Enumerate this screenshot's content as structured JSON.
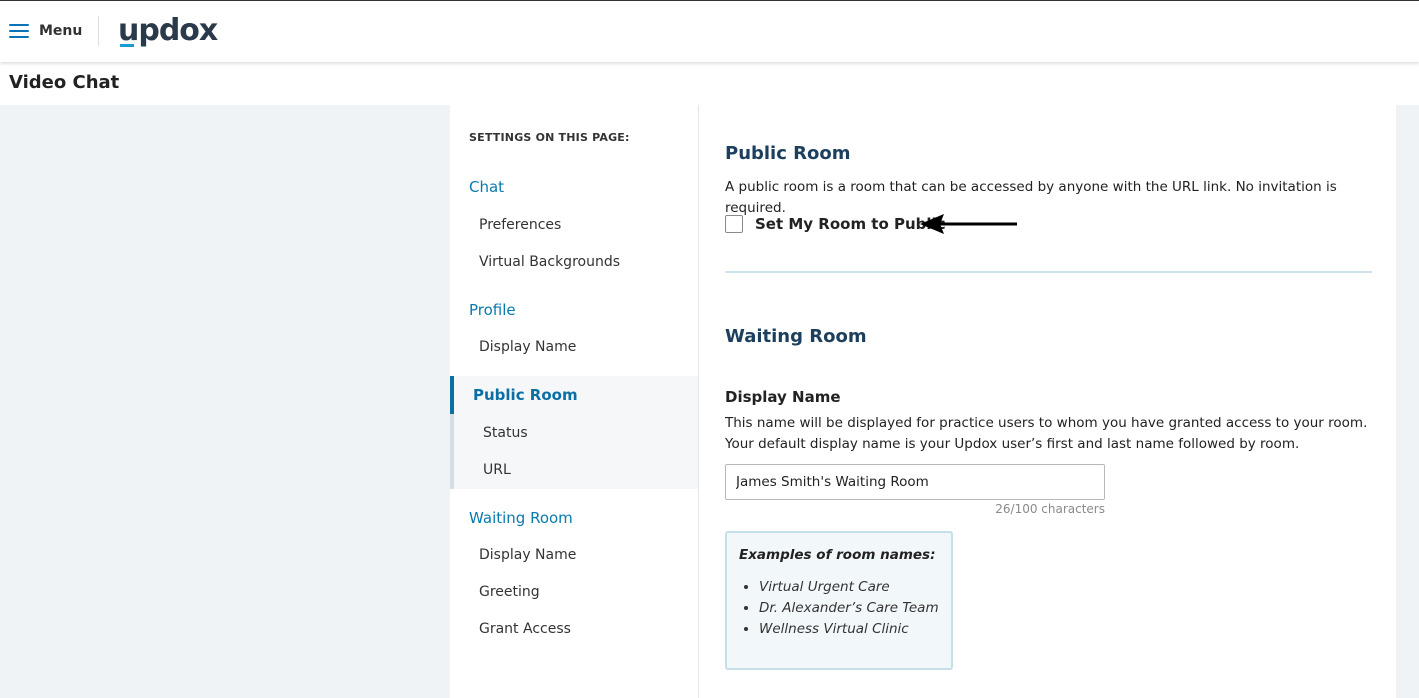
{
  "topbar": {
    "menu_label": "Menu",
    "logo_text": "updox"
  },
  "page": {
    "title": "Video Chat"
  },
  "sidenav": {
    "heading": "SETTINGS ON THIS PAGE:",
    "sections": [
      {
        "label": "Chat",
        "items": [
          "Preferences",
          "Virtual Backgrounds"
        ]
      },
      {
        "label": "Profile",
        "items": [
          "Display Name"
        ]
      },
      {
        "label": "Public Room",
        "items": [
          "Status",
          "URL"
        ],
        "active": true
      },
      {
        "label": "Waiting Room",
        "items": [
          "Display Name",
          "Greeting",
          "Grant Access"
        ]
      }
    ]
  },
  "public_room": {
    "title": "Public Room",
    "description": "A public room is a room that can be accessed by anyone with the URL link. No invitation is required.",
    "checkbox_label": "Set My Room to Public",
    "checked": false
  },
  "waiting_room": {
    "title": "Waiting Room",
    "display_name_label": "Display Name",
    "help_line1": "This name will be displayed for practice users to whom you have granted access to your room.",
    "help_line2": "Your default display name is your Updox user’s first and last name followed by room.",
    "input_value": "James Smith's Waiting Room",
    "char_count": "26/100 characters",
    "examples_title": "Examples of room names:",
    "examples": [
      "Virtual Urgent Care",
      "Dr. Alexander’s Care Team",
      "Wellness Virtual Clinic"
    ]
  },
  "colors": {
    "accent": "#0a7aad",
    "active_nav": "#0a6fa3",
    "section_title": "#1c3f5e",
    "page_bg": "#eff3f6"
  },
  "icons": {
    "menu": "hamburger-icon",
    "annotation": "arrow-left-icon"
  }
}
